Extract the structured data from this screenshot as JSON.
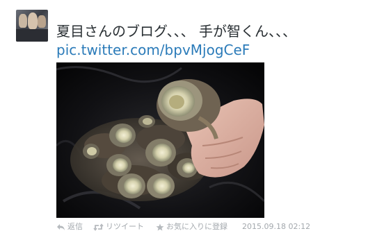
{
  "tweet": {
    "text_line1": "夏目さんのブログ、、、 手が智くん、、、",
    "link": "pic.twitter.com/bpvMjogCeF",
    "timestamp": "2015.09.18 02:12",
    "name_line": "　　　　　　"
  },
  "actions": {
    "reply_label": "返信",
    "retweet_label": "リツイート",
    "favorite_label": "お気に入りに登録"
  },
  "icons": [
    "reply-icon",
    "retweet-icon",
    "star-icon"
  ],
  "colors": {
    "text": "#292f33",
    "link": "#2b7bb9",
    "meta": "#a3a8ad",
    "background": "#ffffff"
  }
}
